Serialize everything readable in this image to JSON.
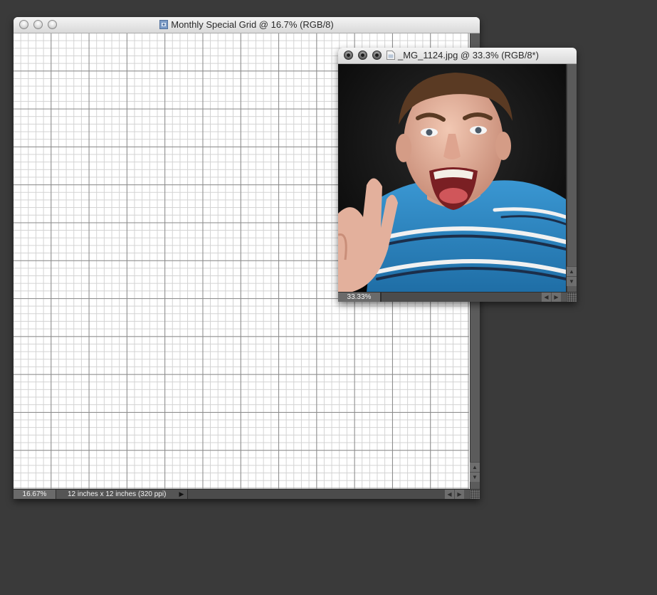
{
  "grid_window": {
    "title": "Monthly Special Grid @ 16.7% (RGB/8)",
    "zoom": "16.67%",
    "doc_info": "12 inches x 12 inches (320 ppi)"
  },
  "photo_window": {
    "title": "_MG_1124.jpg @ 33.3% (RGB/8*)",
    "zoom": "33.33%"
  },
  "icons": {
    "window_controls": [
      "close-icon",
      "minimize-icon",
      "zoom-icon"
    ],
    "grid_doc_icon": "photoshop-document-icon",
    "photo_doc_icon": "jpeg-document-icon"
  },
  "colors": {
    "desktop": "#3a3a3a",
    "chrome_dark": "#555555",
    "shirt_blue": "#2f86c3"
  }
}
